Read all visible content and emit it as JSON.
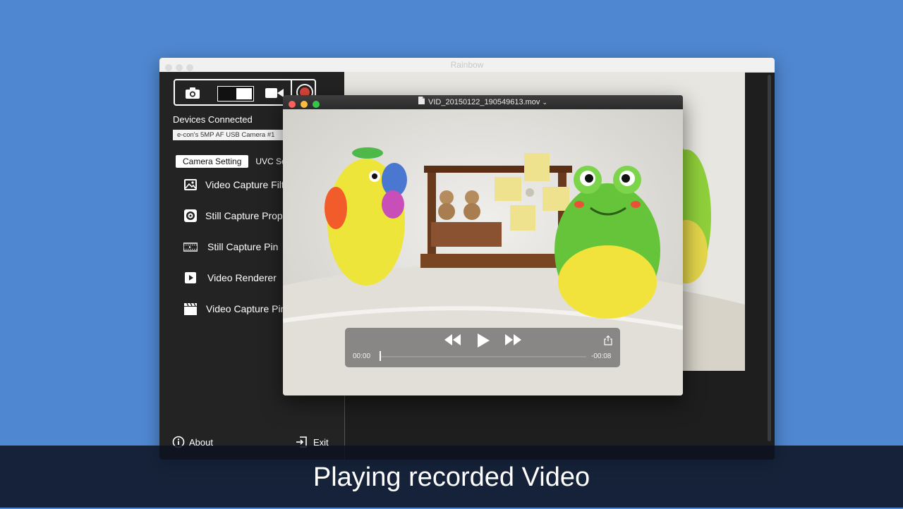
{
  "app": {
    "title": "Rainbow",
    "devices_label": "Devices Connected",
    "device_selected": "e-con's 5MP AF USB Camera #1",
    "tabs": [
      {
        "label": "Camera Setting",
        "active": true
      },
      {
        "label": "UVC Settings",
        "active": false
      }
    ],
    "menu": [
      {
        "label": "Video Capture Filter",
        "icon": "image-icon"
      },
      {
        "label": "Still Capture Properties",
        "icon": "aperture-icon"
      },
      {
        "label": "Still Capture Pin",
        "icon": "film-strip-icon"
      },
      {
        "label": "Video Renderer",
        "icon": "play-icon"
      },
      {
        "label": "Video Capture Pin",
        "icon": "clapperboard-icon"
      }
    ],
    "footer": {
      "about": "About",
      "exit": "Exit"
    }
  },
  "player": {
    "title": "VID_20150122_190549613.mov",
    "time_elapsed": "00:00",
    "time_remaining": "-00:08",
    "progress": 0.0
  },
  "caption": "Playing recorded Video",
  "colors": {
    "desktop": "#4f87d0",
    "sidebar": "#232323",
    "close": "#fc605c",
    "minimize": "#fdbc40",
    "zoom": "#34c84a"
  }
}
